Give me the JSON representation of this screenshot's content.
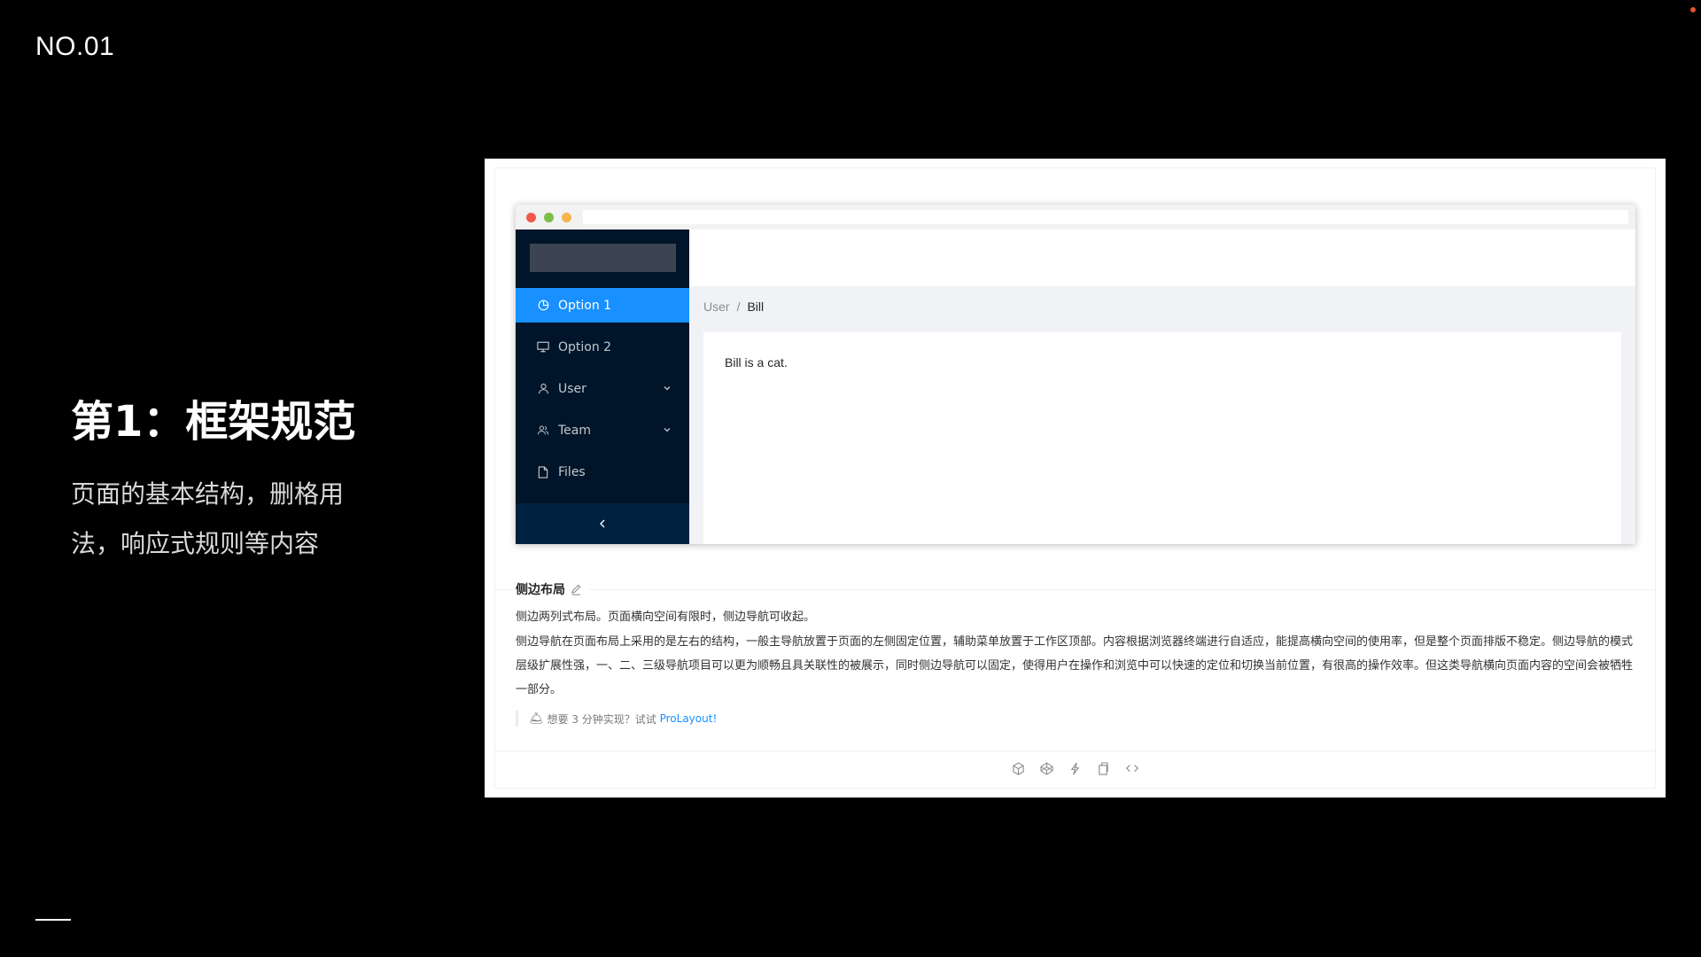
{
  "slide": {
    "number": "NO.01",
    "title": "第1：框架规范",
    "description": "页面的基本结构，删格用法，响应式规则等内容"
  },
  "demo": {
    "menu": [
      {
        "label": "Option 1",
        "icon": "pie-chart-icon",
        "active": true
      },
      {
        "label": "Option 2",
        "icon": "desktop-icon",
        "active": false
      },
      {
        "label": "User",
        "icon": "user-icon",
        "active": false,
        "submenu": true
      },
      {
        "label": "Team",
        "icon": "team-icon",
        "active": false,
        "submenu": true
      },
      {
        "label": "Files",
        "icon": "file-icon",
        "active": false
      }
    ],
    "collapse_icon": "chevron-left-icon",
    "breadcrumb": {
      "parent": "User",
      "separator": "/",
      "current": "Bill"
    },
    "content_text": "Bill is a cat."
  },
  "doc": {
    "title": "侧边布局",
    "paragraph1": "侧边两列式布局。页面横向空间有限时，侧边导航可收起。",
    "paragraph2": "侧边导航在页面布局上采用的是左右的结构，一般主导航放置于页面的左侧固定位置，辅助菜单放置于工作区顶部。内容根据浏览器终端进行自适应，能提高横向空间的使用率，但是整个页面排版不稳定。侧边导航的模式层级扩展性强，一、二、三级导航项目可以更为顺畅且具关联性的被展示，同时侧边导航可以固定，使得用户在操作和浏览中可以快速的定位和切换当前位置，有很高的操作效率。但这类导航横向页面内容的空间会被牺牲一部分。",
    "tip_prefix": "想要 3 分钟实现？试试",
    "tip_link": "ProLayout",
    "tip_suffix": "!",
    "actions": [
      "codesandbox-icon",
      "codepen-icon",
      "thunderbolt-icon",
      "copy-icon",
      "code-icon"
    ]
  },
  "colors": {
    "accent": "#1890ff",
    "sider": "#001529",
    "sider_trigger": "#002140",
    "background": "#000000"
  }
}
